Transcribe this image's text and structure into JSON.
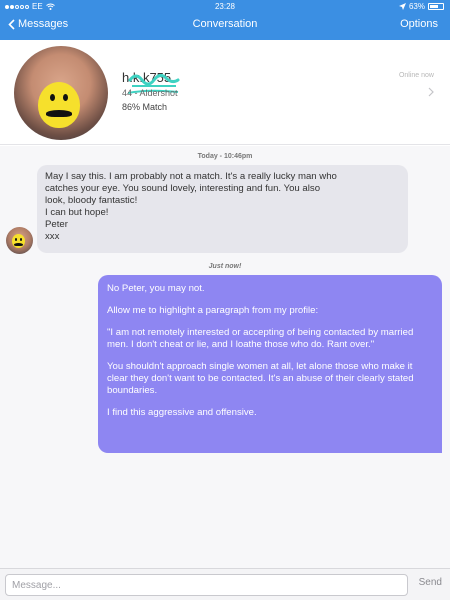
{
  "status_bar": {
    "carrier": "EE",
    "time": "23:28",
    "battery": "63%",
    "battery_level": 0.63
  },
  "nav": {
    "back_label": "Messages",
    "title": "Conversation",
    "options_label": "Options"
  },
  "profile": {
    "username": "h.k.k755",
    "location": "44 - Aldershot",
    "match": "86% Match",
    "status": "Online now"
  },
  "chat": {
    "timestamp_1": "Today - 10:46pm",
    "incoming": {
      "lines": [
        "May I say this. I am probably not a match. It's a really lucky man who",
        "catches your eye. You sound lovely, interesting and fun. You also",
        "look, bloody fantastic!",
        "I can but hope!",
        "Peter",
        "xxx"
      ]
    },
    "timestamp_2": "Just now!",
    "outgoing": {
      "paragraphs": [
        "No Peter, you may not.",
        "Allow me to highlight a paragraph from my profile:",
        "\"I am not remotely interested or accepting of being contacted by married men. I don't cheat or lie, and I loathe those who do. Rant over.\"",
        "You shouldn't approach single women at all, let alone those who make it clear they don't want to be contacted. It's an abuse of their clearly stated boundaries.",
        "I find this aggressive and offensive."
      ]
    }
  },
  "composer": {
    "placeholder": "Message...",
    "send_label": "Send"
  },
  "colors": {
    "nav": "#3b8fe3",
    "outgoing_bubble": "#8e86f2",
    "incoming_bubble": "#e6e6ec",
    "emoji": "#f6e02c"
  }
}
